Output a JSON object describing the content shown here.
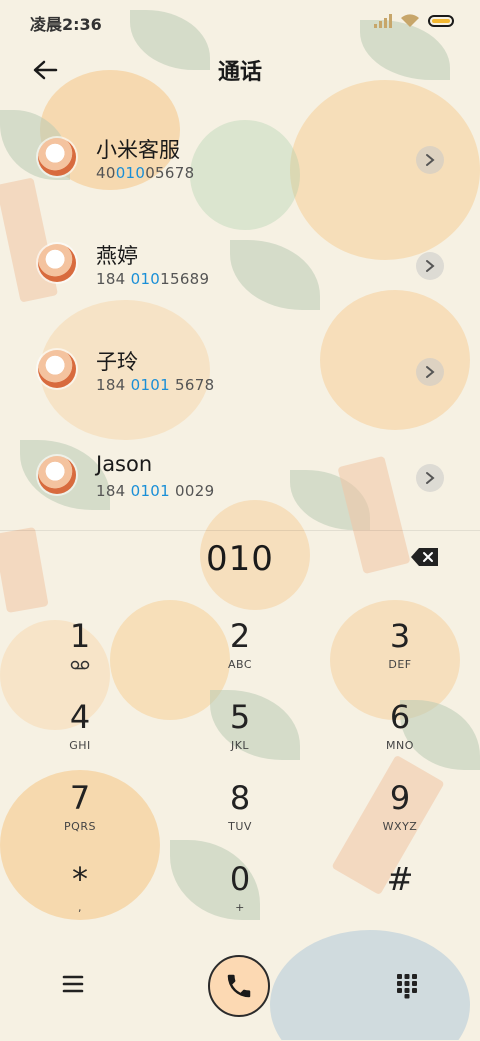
{
  "status_bar": {
    "time": "凌晨2:36"
  },
  "header": {
    "title": "通话"
  },
  "contacts": [
    {
      "name": "小米客服",
      "number_pre": "40",
      "number_hl": "010",
      "number_post": "05678"
    },
    {
      "name": "燕婷",
      "number_pre": "184 ",
      "number_hl": "010",
      "number_post": "15689"
    },
    {
      "name": "子玲",
      "number_pre": "184 ",
      "number_hl": "0101",
      "number_post": " 5678"
    },
    {
      "name": "Jason",
      "number_pre": "184 ",
      "number_hl": "0101",
      "number_post": " 0029"
    }
  ],
  "dialer": {
    "input": "010",
    "keys": [
      {
        "digit": "1",
        "letters": ""
      },
      {
        "digit": "2",
        "letters": "ABC"
      },
      {
        "digit": "3",
        "letters": "DEF"
      },
      {
        "digit": "4",
        "letters": "GHI"
      },
      {
        "digit": "5",
        "letters": "JKL"
      },
      {
        "digit": "6",
        "letters": "MNO"
      },
      {
        "digit": "7",
        "letters": "PQRS"
      },
      {
        "digit": "8",
        "letters": "TUV"
      },
      {
        "digit": "9",
        "letters": "WXYZ"
      },
      {
        "digit": "*",
        "letters": ","
      },
      {
        "digit": "0",
        "letters": "+"
      },
      {
        "digit": "#",
        "letters": ""
      }
    ]
  },
  "colors": {
    "accent": "#1a8fd7",
    "call_button": "#fcd9b3",
    "background": "#f6f1e3"
  }
}
